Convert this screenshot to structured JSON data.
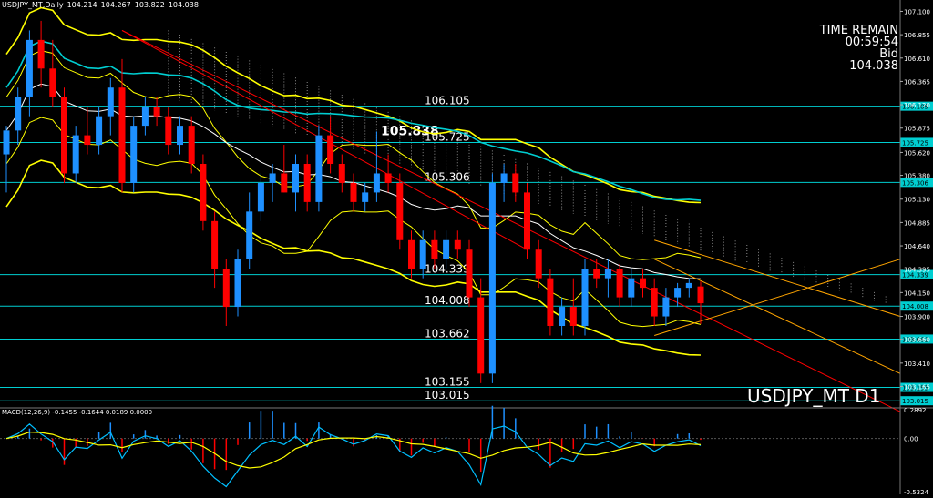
{
  "header": {
    "symbol": "USDJPY_MT,Daily",
    "open": "104.214",
    "high": "104.267",
    "low": "103.822",
    "close": "104.038"
  },
  "timer": {
    "title": "TIME REMAIN",
    "time": "00:59:54",
    "bid_label": "Bid",
    "bid_value": "104.038"
  },
  "symbol_big": "USDJPY_MT D1",
  "macd_label": "MACD(12,26,9) -0.1455 -0.1644 0.0189 0.0000",
  "colors": {
    "background": "#000000",
    "bull": "#1e90ff",
    "bear": "#ff0000",
    "band": "#ffff00",
    "ma": "#00ced1",
    "level": "#00ced1",
    "trend_red": "#ff0000",
    "trend_orange": "#ffa500",
    "macd_signal": "#ffff00",
    "macd_line": "#00bfff"
  },
  "chart_data": {
    "type": "candlestick",
    "ylim": [
      102.95,
      107.2
    ],
    "y_ticks": [
      "107.100",
      "106.855",
      "106.610",
      "106.365",
      "106.120",
      "105.875",
      "105.620",
      "105.380",
      "105.130",
      "104.885",
      "104.640",
      "104.395",
      "104.150",
      "103.900",
      "103.660",
      "103.410",
      "103.165"
    ],
    "level_lines": [
      {
        "label": "106.105",
        "value": 106.105
      },
      {
        "label": "105.725",
        "value": 105.725
      },
      {
        "label": "105.306",
        "value": 105.306
      },
      {
        "label": "104.339",
        "value": 104.339
      },
      {
        "label": "104.008",
        "value": 104.008
      },
      {
        "label": "103.662",
        "value": 103.662
      },
      {
        "label": "103.155",
        "value": 103.155
      },
      {
        "label": "103.015",
        "value": 103.015
      }
    ],
    "annotation": {
      "label": "105.838",
      "value": 105.838
    },
    "candles": [
      {
        "o": 105.6,
        "h": 105.9,
        "l": 105.2,
        "c": 105.85
      },
      {
        "o": 105.85,
        "h": 106.3,
        "l": 105.7,
        "c": 106.2
      },
      {
        "o": 106.2,
        "h": 106.9,
        "l": 106.0,
        "c": 106.8
      },
      {
        "o": 106.8,
        "h": 107.0,
        "l": 106.3,
        "c": 106.5
      },
      {
        "o": 106.5,
        "h": 106.8,
        "l": 106.1,
        "c": 106.2
      },
      {
        "o": 106.2,
        "h": 106.3,
        "l": 105.3,
        "c": 105.4
      },
      {
        "o": 105.4,
        "h": 105.9,
        "l": 105.3,
        "c": 105.8
      },
      {
        "o": 105.8,
        "h": 106.1,
        "l": 105.6,
        "c": 105.7
      },
      {
        "o": 105.7,
        "h": 106.1,
        "l": 105.6,
        "c": 106.0
      },
      {
        "o": 106.0,
        "h": 106.4,
        "l": 105.8,
        "c": 106.3
      },
      {
        "o": 106.3,
        "h": 106.6,
        "l": 105.2,
        "c": 105.3
      },
      {
        "o": 105.3,
        "h": 106.0,
        "l": 105.2,
        "c": 105.9
      },
      {
        "o": 105.9,
        "h": 106.2,
        "l": 105.8,
        "c": 106.1
      },
      {
        "o": 106.1,
        "h": 106.2,
        "l": 105.9,
        "c": 106.0
      },
      {
        "o": 106.0,
        "h": 106.1,
        "l": 105.6,
        "c": 105.7
      },
      {
        "o": 105.7,
        "h": 106.0,
        "l": 105.6,
        "c": 105.9
      },
      {
        "o": 105.9,
        "h": 106.0,
        "l": 105.4,
        "c": 105.5
      },
      {
        "o": 105.5,
        "h": 105.6,
        "l": 104.8,
        "c": 104.9
      },
      {
        "o": 104.9,
        "h": 105.0,
        "l": 104.2,
        "c": 104.4
      },
      {
        "o": 104.4,
        "h": 104.5,
        "l": 103.8,
        "c": 104.0
      },
      {
        "o": 104.0,
        "h": 104.6,
        "l": 103.9,
        "c": 104.5
      },
      {
        "o": 104.5,
        "h": 105.2,
        "l": 104.4,
        "c": 105.0
      },
      {
        "o": 105.0,
        "h": 105.4,
        "l": 104.9,
        "c": 105.3
      },
      {
        "o": 105.3,
        "h": 105.5,
        "l": 105.1,
        "c": 105.4
      },
      {
        "o": 105.4,
        "h": 105.7,
        "l": 105.2,
        "c": 105.2
      },
      {
        "o": 105.2,
        "h": 105.6,
        "l": 105.0,
        "c": 105.5
      },
      {
        "o": 105.5,
        "h": 105.6,
        "l": 105.0,
        "c": 105.1
      },
      {
        "o": 105.1,
        "h": 105.9,
        "l": 105.0,
        "c": 105.8
      },
      {
        "o": 105.8,
        "h": 106.0,
        "l": 105.4,
        "c": 105.5
      },
      {
        "o": 105.5,
        "h": 105.6,
        "l": 105.2,
        "c": 105.3
      },
      {
        "o": 105.3,
        "h": 105.4,
        "l": 105.0,
        "c": 105.1
      },
      {
        "o": 105.1,
        "h": 105.3,
        "l": 105.0,
        "c": 105.2
      },
      {
        "o": 105.2,
        "h": 105.84,
        "l": 105.1,
        "c": 105.4
      },
      {
        "o": 105.4,
        "h": 105.6,
        "l": 105.2,
        "c": 105.3
      },
      {
        "o": 105.3,
        "h": 105.4,
        "l": 104.6,
        "c": 104.7
      },
      {
        "o": 104.7,
        "h": 104.8,
        "l": 104.3,
        "c": 104.4
      },
      {
        "o": 104.4,
        "h": 104.8,
        "l": 104.3,
        "c": 104.7
      },
      {
        "o": 104.7,
        "h": 104.8,
        "l": 104.4,
        "c": 104.5
      },
      {
        "o": 104.5,
        "h": 104.8,
        "l": 104.4,
        "c": 104.7
      },
      {
        "o": 104.7,
        "h": 104.8,
        "l": 104.5,
        "c": 104.6
      },
      {
        "o": 104.6,
        "h": 104.7,
        "l": 104.0,
        "c": 104.1
      },
      {
        "o": 104.1,
        "h": 104.3,
        "l": 103.2,
        "c": 103.3
      },
      {
        "o": 103.3,
        "h": 105.4,
        "l": 103.2,
        "c": 105.3
      },
      {
        "o": 105.3,
        "h": 105.5,
        "l": 105.1,
        "c": 105.4
      },
      {
        "o": 105.4,
        "h": 105.5,
        "l": 105.1,
        "c": 105.2
      },
      {
        "o": 105.2,
        "h": 105.3,
        "l": 104.5,
        "c": 104.6
      },
      {
        "o": 104.6,
        "h": 104.7,
        "l": 104.2,
        "c": 104.3
      },
      {
        "o": 104.3,
        "h": 104.4,
        "l": 103.7,
        "c": 103.8
      },
      {
        "o": 103.8,
        "h": 104.1,
        "l": 103.7,
        "c": 104.0
      },
      {
        "o": 104.0,
        "h": 104.3,
        "l": 103.7,
        "c": 103.8
      },
      {
        "o": 103.8,
        "h": 104.5,
        "l": 103.7,
        "c": 104.4
      },
      {
        "o": 104.4,
        "h": 104.5,
        "l": 104.2,
        "c": 104.3
      },
      {
        "o": 104.3,
        "h": 104.5,
        "l": 104.1,
        "c": 104.4
      },
      {
        "o": 104.4,
        "h": 104.45,
        "l": 104.0,
        "c": 104.1
      },
      {
        "o": 104.1,
        "h": 104.4,
        "l": 104.0,
        "c": 104.3
      },
      {
        "o": 104.3,
        "h": 104.4,
        "l": 104.1,
        "c": 104.2
      },
      {
        "o": 104.2,
        "h": 104.3,
        "l": 103.8,
        "c": 103.9
      },
      {
        "o": 103.9,
        "h": 104.2,
        "l": 103.8,
        "c": 104.1
      },
      {
        "o": 104.1,
        "h": 104.25,
        "l": 104.0,
        "c": 104.2
      },
      {
        "o": 104.2,
        "h": 104.3,
        "l": 104.1,
        "c": 104.25
      },
      {
        "o": 104.214,
        "h": 104.267,
        "l": 103.822,
        "c": 104.038
      }
    ],
    "macd_ylim": [
      -0.5324,
      0.2892
    ],
    "macd_ticks": [
      "0.2892",
      "0.00",
      "-0.5324"
    ]
  }
}
